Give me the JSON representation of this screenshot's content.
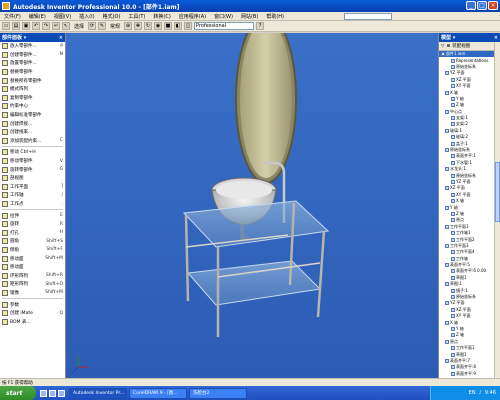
{
  "window": {
    "title": "Autodesk Inventor Professional 10.0 - [部件1.iam]"
  },
  "menu": [
    "文件(F)",
    "编辑(E)",
    "视图(V)",
    "插入(I)",
    "格式(O)",
    "工具(T)",
    "转换(C)",
    "应用程序(A)",
    "窗口(W)",
    "网站(B)",
    "帮助(H)"
  ],
  "toolbar": {
    "select_label": "选择",
    "material_label": "常规",
    "color_label": "颜色",
    "style_value": "Professional"
  },
  "left_panel": {
    "header": "部件面板 ▾",
    "tools": [
      {
        "label": "放入零部件...",
        "short": "P"
      },
      {
        "label": "创建零部件...",
        "short": "N"
      },
      {
        "label": "放置零部件...",
        "short": ""
      },
      {
        "label": "替换零部件",
        "short": ""
      },
      {
        "label": "替换所有零部件",
        "short": ""
      },
      {
        "label": "模式阵列",
        "short": ""
      },
      {
        "label": "复制零部件",
        "short": ""
      },
      {
        "label": "约束中心",
        "short": ""
      },
      {
        "label": "编辑标准零部件",
        "short": ""
      },
      {
        "label": "创建焊接...",
        "short": ""
      },
      {
        "label": "创建线束...",
        "short": ""
      },
      {
        "label": "添加装配约束...",
        "short": "C"
      },
      {
        "label": "移动 Ctrl+H",
        "short": ""
      },
      {
        "label": "移动零部件",
        "short": "V"
      },
      {
        "label": "旋转零部件",
        "short": "G"
      },
      {
        "label": "剖视图",
        "short": ""
      },
      {
        "label": "工作平面",
        "short": "]"
      },
      {
        "label": "工作轴",
        "short": "/"
      },
      {
        "label": "工作点",
        "short": "."
      },
      {
        "label": "拉伸",
        "short": "E"
      },
      {
        "label": "旋转",
        "short": "R"
      },
      {
        "label": "打孔",
        "short": "H"
      },
      {
        "label": "圆角",
        "short": "Shift+S"
      },
      {
        "label": "倒角",
        "short": "Shift+F"
      },
      {
        "label": "移动面",
        "short": "Shift+M"
      },
      {
        "label": "移动面",
        "short": ""
      },
      {
        "label": "环形阵列",
        "short": "Shift+R"
      },
      {
        "label": "矩形阵列",
        "short": "Shift+O"
      },
      {
        "label": "镜像",
        "short": "Shift+M"
      },
      {
        "label": "参数",
        "short": ""
      },
      {
        "label": "创建 iMate",
        "short": "Q"
      },
      {
        "label": "BOM 表...",
        "short": ""
      }
    ]
  },
  "right_panel": {
    "header": "模型 ▾",
    "toolbar_label": "装配视图",
    "tree": [
      {
        "label": "部件1.iam",
        "sel": true
      },
      {
        "label": "Representations",
        "sel": false
      },
      {
        "label": "原始坐标系",
        "sel": false
      },
      {
        "label": "YZ 平面",
        "sel": false
      },
      {
        "label": "XZ 平面",
        "sel": false
      },
      {
        "label": "XY 平面",
        "sel": false
      },
      {
        "label": "X 轴",
        "sel": false
      },
      {
        "label": "Y 轴",
        "sel": false
      },
      {
        "label": "Z 轴",
        "sel": false
      },
      {
        "label": "中心点",
        "sel": false
      },
      {
        "label": "支架:1",
        "sel": false
      },
      {
        "label": "支架:2",
        "sel": false
      },
      {
        "label": "玻璃:1",
        "sel": false
      },
      {
        "label": "玻璃:2",
        "sel": false
      },
      {
        "label": "盆子:1",
        "sel": false
      },
      {
        "label": "原始坐标系",
        "sel": false
      },
      {
        "label": "表面齐平:1",
        "sel": false
      },
      {
        "label": "下水管:1",
        "sel": false
      },
      {
        "label": "水龙头:1",
        "sel": false
      },
      {
        "label": "原始坐标系",
        "sel": false
      },
      {
        "label": "YZ 平面",
        "sel": false
      },
      {
        "label": "XZ 平面",
        "sel": false
      },
      {
        "label": "XY 平面",
        "sel": false
      },
      {
        "label": "X 轴",
        "sel": false
      },
      {
        "label": "Y 轴",
        "sel": false
      },
      {
        "label": "Z 轴",
        "sel": false
      },
      {
        "label": "原点",
        "sel": false
      },
      {
        "label": "工作平面1",
        "sel": false
      },
      {
        "label": "工作轴1",
        "sel": false
      },
      {
        "label": "工作平面2",
        "sel": false
      },
      {
        "label": "工作平面3",
        "sel": false
      },
      {
        "label": "工作平面4",
        "sel": false
      },
      {
        "label": "工作轴",
        "sel": false
      },
      {
        "label": "表面齐平:5",
        "sel": false
      },
      {
        "label": "表面齐平:6 0.00",
        "sel": false
      },
      {
        "label": "草图1",
        "sel": false
      },
      {
        "label": "草图:1",
        "sel": false
      },
      {
        "label": "镜子:1",
        "sel": false
      },
      {
        "label": "原始坐标系",
        "sel": false
      },
      {
        "label": "YZ 平面",
        "sel": false
      },
      {
        "label": "XZ 平面",
        "sel": false
      },
      {
        "label": "XY 平面",
        "sel": false
      },
      {
        "label": "X 轴",
        "sel": false
      },
      {
        "label": "Y 轴",
        "sel": false
      },
      {
        "label": "Z 轴",
        "sel": false
      },
      {
        "label": "原点",
        "sel": false
      },
      {
        "label": "工作平面1",
        "sel": false
      },
      {
        "label": "草图1",
        "sel": false
      },
      {
        "label": "表面齐平:7",
        "sel": false
      },
      {
        "label": "表面齐平:8",
        "sel": false
      },
      {
        "label": "表面齐平:9",
        "sel": false
      }
    ]
  },
  "status": {
    "text": "按 F1 获得帮助"
  },
  "taskbar": {
    "start": "start",
    "tasks": [
      {
        "label": "Autodesk Inventor Pr...",
        "active": true
      },
      {
        "label": "CorelDRAW 9 - [图...",
        "active": false
      },
      {
        "label": "洗脸台2",
        "active": false
      }
    ],
    "tray": {
      "lang": "EN",
      "time": "9:46"
    }
  },
  "colors": {
    "viewport_bg": "#3a70c8",
    "titlebar": "#0a5ad8",
    "taskbar": "#245edb",
    "start": "#3c9a34"
  }
}
